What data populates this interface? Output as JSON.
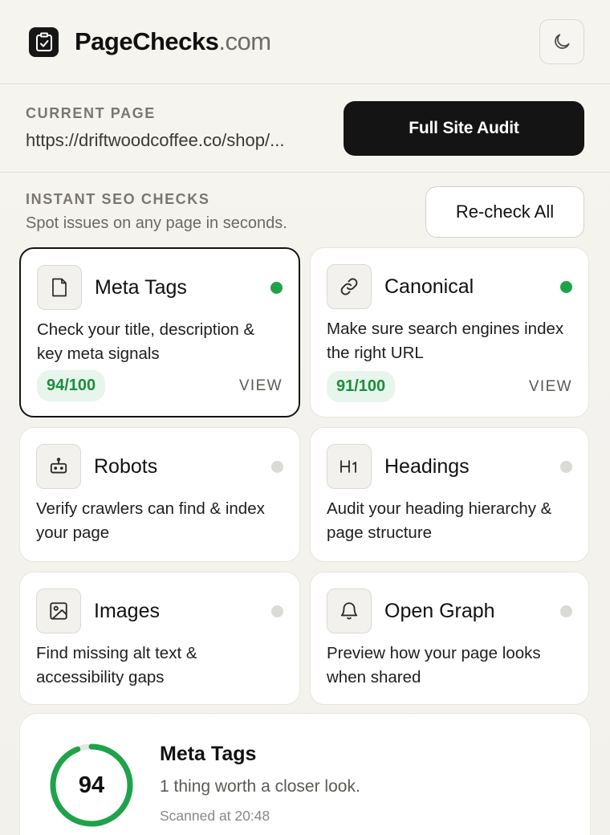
{
  "header": {
    "brand_name": "PageChecks",
    "brand_tld": ".com",
    "logo_icon": "clipboard-check-icon",
    "theme_icon": "moon-icon"
  },
  "current_page": {
    "label": "CURRENT PAGE",
    "url": "https://driftwoodcoffee.co/shop/...",
    "audit_button": "Full Site Audit"
  },
  "section": {
    "title": "INSTANT SEO CHECKS",
    "subtitle": "Spot issues on any page in seconds.",
    "recheck_button": "Re-check All"
  },
  "checks": [
    {
      "title": "Meta Tags",
      "description": "Check your title, description & key meta signals",
      "score": "94/100",
      "action": "VIEW",
      "status": "ok",
      "icon": "file-icon",
      "selected": true
    },
    {
      "title": "Canonical",
      "description": "Make sure search engines index the right URL",
      "score": "91/100",
      "action": "VIEW",
      "status": "ok",
      "icon": "link-icon",
      "selected": false
    },
    {
      "title": "Robots",
      "description": "Verify crawlers can find & index your page",
      "status": "pending",
      "icon": "robot-icon"
    },
    {
      "title": "Headings",
      "description": "Audit your heading hierarchy & page structure",
      "status": "pending",
      "icon": "heading-h1-icon"
    },
    {
      "title": "Images",
      "description": "Find missing alt text & accessibility gaps",
      "status": "pending",
      "icon": "image-icon"
    },
    {
      "title": "Open Graph",
      "description": "Preview how your page looks when shared",
      "status": "pending",
      "icon": "bell-icon"
    }
  ],
  "summary": {
    "score": "94",
    "score_fraction": 0.94,
    "title": "Meta Tags",
    "message": "1 thing worth a closer look.",
    "scanned": "Scanned at 20:48"
  },
  "colors": {
    "ok": "#1ea34a",
    "pending": "#dcdad6",
    "accent_dark": "#141414",
    "pill_bg": "#e8f5ec",
    "pill_text": "#1b8d3f"
  }
}
